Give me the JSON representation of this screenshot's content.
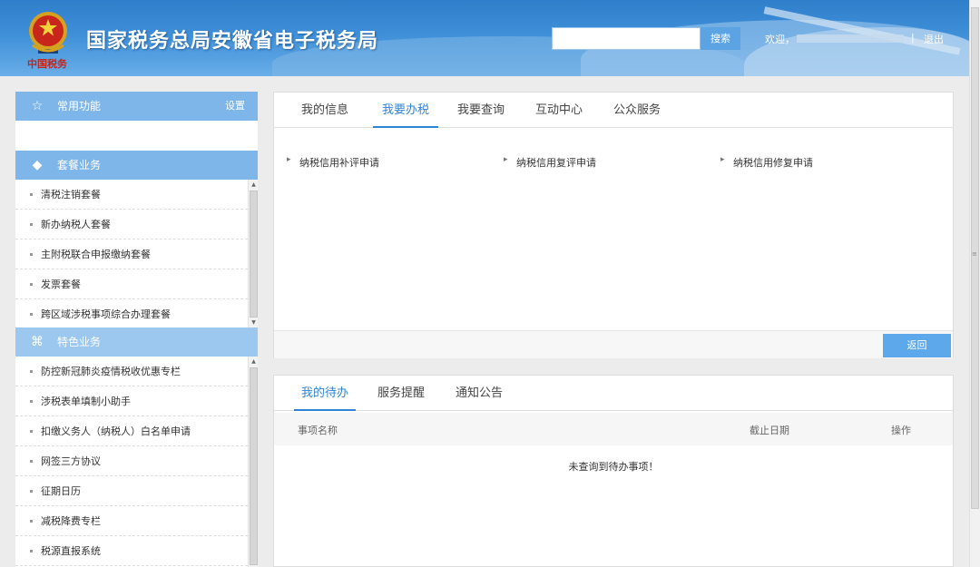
{
  "header": {
    "emblem_text": "中国税务",
    "title": "国家税务总局安徽省电子税务局",
    "search_button": "搜索",
    "welcome": "欢迎，",
    "separator": "|",
    "logout": "退出"
  },
  "sidebar": {
    "common": {
      "label": "常用功能",
      "settings": "设置"
    },
    "package": {
      "label": "套餐业务",
      "items": [
        "清税注销套餐",
        "新办纳税人套餐",
        "主附税联合申报缴纳套餐",
        "发票套餐",
        "跨区域涉税事项综合办理套餐"
      ]
    },
    "special": {
      "label": "特色业务",
      "items": [
        "防控新冠肺炎疫情税收优惠专栏",
        "涉税表单填制小助手",
        "扣缴义务人（纳税人）白名单申请",
        "网签三方协议",
        "征期日历",
        "减税降费专栏",
        "税源直报系统"
      ]
    }
  },
  "main": {
    "tabs": [
      "我的信息",
      "我要办税",
      "我要查询",
      "互动中心",
      "公众服务"
    ],
    "active_tab": "我要办税",
    "links": [
      "纳税信用补评申请",
      "纳税信用复评申请",
      "纳税信用修复申请"
    ],
    "back_button": "返回"
  },
  "todo": {
    "tabs": [
      "我的待办",
      "服务提醒",
      "通知公告"
    ],
    "columns": {
      "name": "事项名称",
      "deadline": "截止日期",
      "action": "操作"
    },
    "empty_message": "未查询到待办事项！"
  },
  "colors": {
    "accent": "#3283d4",
    "header_blue": "#3e8fd8",
    "sidebar_head": "#7fb6ea"
  }
}
